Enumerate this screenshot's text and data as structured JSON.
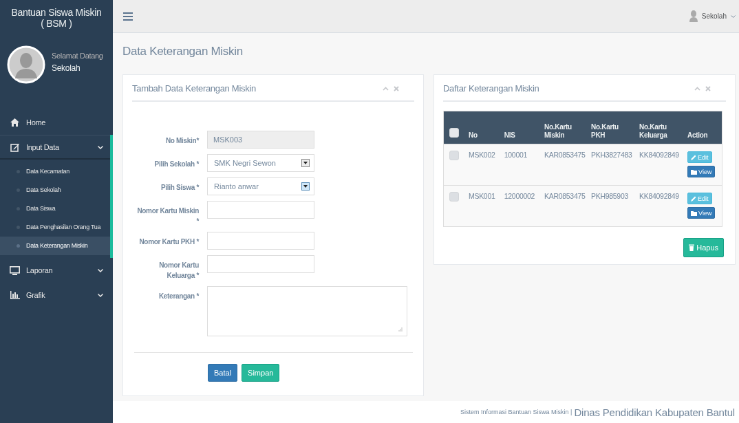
{
  "sidebar": {
    "title_lines": [
      "Bantuan Siswa Miskin",
      "( BSM )"
    ],
    "welcome": "Selamat Datang",
    "user": "Sekolah",
    "menu": [
      {
        "label": "Home",
        "kind": "link",
        "selected": false
      },
      {
        "label": "Input Data",
        "kind": "group",
        "selected": true,
        "expanded": true,
        "children": [
          {
            "label": "Data Kecamatan",
            "selected": false
          },
          {
            "label": "Data Sekolah",
            "selected": false
          },
          {
            "label": "Data Siswa",
            "selected": false
          },
          {
            "label": "Data Penghasilan Orang Tua",
            "selected": false
          },
          {
            "label": "Data Keterangan Miskin",
            "selected": true
          }
        ]
      },
      {
        "label": "Laporan",
        "kind": "group",
        "selected": false,
        "expanded": false
      },
      {
        "label": "Grafik",
        "kind": "group",
        "selected": false,
        "expanded": false
      }
    ]
  },
  "top_bar": {
    "user": "Sekolah"
  },
  "page_title": "Data Keterangan Miskin",
  "form_panel": {
    "title": "Tambah Data Keterangan Miskin",
    "fields": [
      {
        "label": "No Miskin*",
        "kind": "readonly",
        "value": "MSK003"
      },
      {
        "label": "Pilih Sekolah *",
        "kind": "select",
        "value": "SMK Negri Sewon",
        "focused": false
      },
      {
        "label": "Pilih Siswa *",
        "kind": "select",
        "value": "Rianto anwar",
        "focused": true
      },
      {
        "label": "Nomor Kartu Miskin *",
        "kind": "text"
      },
      {
        "label": "Nomor Kartu PKH *",
        "kind": "text"
      },
      {
        "label": "Nomor Kartu Keluarga *",
        "kind": "text"
      },
      {
        "label": "Keterangan *",
        "kind": "textarea"
      }
    ],
    "buttons": [
      {
        "label": "Batal",
        "kind": "primary"
      },
      {
        "label": "Simpan",
        "kind": "success"
      }
    ]
  },
  "list_panel": {
    "title": "Daftar Keterangan Miskin",
    "header_checked": false,
    "columns": [
      "No",
      "NIS",
      "No.Kartu Miskin",
      "No.Kartu PKH",
      "No.Kartu Keluarga",
      "Action"
    ],
    "rows": [
      {
        "checked": false,
        "cells": [
          "MSK002",
          "100001",
          "KAR0853475",
          "PKH3827483",
          "KK84092849"
        ],
        "actions": [
          "Edit",
          "View"
        ]
      },
      {
        "checked": false,
        "cells": [
          "MSK001",
          "12000002",
          "KAR0853475",
          "PKH985903",
          "KK84092849"
        ],
        "actions": [
          "Edit",
          "View"
        ]
      }
    ],
    "delete_button": "Hapus"
  },
  "footer": {
    "left": "Sistem Informasi Bantuan Siswa Miskin |",
    "right": "Dinas Pendidikan Kabupaten Bantul"
  }
}
